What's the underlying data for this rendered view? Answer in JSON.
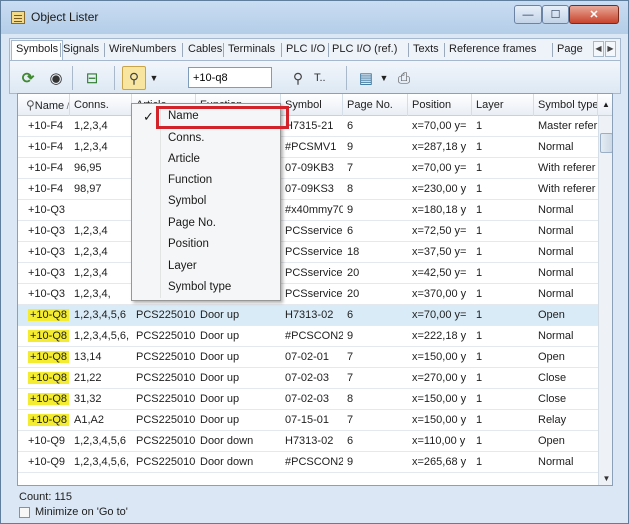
{
  "window": {
    "title": "Object Lister"
  },
  "tabs": [
    {
      "label": "Symbols",
      "active": true
    },
    {
      "label": "Signals"
    },
    {
      "label": "WireNumbers"
    },
    {
      "label": "Cables"
    },
    {
      "label": "Terminals"
    },
    {
      "label": "PLC I/O"
    },
    {
      "label": "PLC I/O (ref.)"
    },
    {
      "label": "Texts"
    },
    {
      "label": "Reference frames"
    },
    {
      "label": "Page"
    }
  ],
  "toolbar": {
    "search_value": "+10-q8",
    "find_label": "T.."
  },
  "columns": [
    "Name",
    "Conns.",
    "Article",
    "Function",
    "Symbol",
    "Page No.",
    "Position",
    "Layer",
    "Symbol type"
  ],
  "rows": [
    {
      "name": "+10-F4",
      "conns": "1,2,3,4",
      "article": "",
      "function": "",
      "symbol": "H7315-21",
      "page": "6",
      "position": "x=70,00 y=",
      "layer": "1",
      "type": "Master refer"
    },
    {
      "name": "+10-F4",
      "conns": "1,2,3,4",
      "article": "",
      "function": "",
      "symbol": "#PCSMV1",
      "page": "9",
      "position": "x=287,18 y",
      "layer": "1",
      "type": "Normal"
    },
    {
      "name": "+10-F4",
      "conns": "96,95",
      "article": "",
      "function": "",
      "symbol": "07-09KB3",
      "page": "7",
      "position": "x=70,00 y=",
      "layer": "1",
      "type": "With referer"
    },
    {
      "name": "+10-F4",
      "conns": "98,97",
      "article": "",
      "function": "",
      "symbol": "07-09KS3",
      "page": "8",
      "position": "x=230,00 y",
      "layer": "1",
      "type": "With referer"
    },
    {
      "name": "+10-Q3",
      "conns": "",
      "article": "",
      "function": "",
      "symbol": "#x40mmy70",
      "page": "9",
      "position": "x=180,18 y",
      "layer": "1",
      "type": "Normal"
    },
    {
      "name": "+10-Q3",
      "conns": "1,2,3,4",
      "article": "",
      "function": "",
      "symbol": "PCSserviceb",
      "page": "6",
      "position": "x=72,50 y=",
      "layer": "1",
      "type": "Normal"
    },
    {
      "name": "+10-Q3",
      "conns": "1,2,3,4",
      "article": "",
      "function": "",
      "symbol": "PCSserviceb",
      "page": "18",
      "position": "x=37,50 y=",
      "layer": "1",
      "type": "Normal"
    },
    {
      "name": "+10-Q3",
      "conns": "1,2,3,4",
      "article": "",
      "function": "",
      "symbol": "PCSserviceb",
      "page": "20",
      "position": "x=42,50 y=",
      "layer": "1",
      "type": "Normal"
    },
    {
      "name": "+10-Q3",
      "conns": "1,2,3,4,",
      "article": "",
      "function": "",
      "symbol": "PCSserviceb",
      "page": "20",
      "position": "x=370,00 y",
      "layer": "1",
      "type": "Normal"
    },
    {
      "name": "+10-Q8",
      "conns": "1,2,3,4,5,6",
      "article": "PCS2250106",
      "function": "Door up",
      "symbol": "H7313-02",
      "page": "6",
      "position": "x=70,00 y=",
      "layer": "1",
      "type": "Open",
      "highlight": true,
      "selected": true
    },
    {
      "name": "+10-Q8",
      "conns": "1,2,3,4,5,6,",
      "article": "PCS2250106",
      "function": "Door up",
      "symbol": "#PCSCON2",
      "page": "9",
      "position": "x=222,18 y",
      "layer": "1",
      "type": "Normal",
      "highlight": true
    },
    {
      "name": "+10-Q8",
      "conns": "13,14",
      "article": "PCS2250106",
      "function": "Door up",
      "symbol": "07-02-01",
      "page": "7",
      "position": "x=150,00 y",
      "layer": "1",
      "type": "Open",
      "highlight": true
    },
    {
      "name": "+10-Q8",
      "conns": "21,22",
      "article": "PCS2250106",
      "function": "Door up",
      "symbol": "07-02-03",
      "page": "7",
      "position": "x=270,00 y",
      "layer": "1",
      "type": "Close",
      "highlight": true
    },
    {
      "name": "+10-Q8",
      "conns": "31,32",
      "article": "PCS2250106",
      "function": "Door up",
      "symbol": "07-02-03",
      "page": "8",
      "position": "x=150,00 y",
      "layer": "1",
      "type": "Close",
      "highlight": true
    },
    {
      "name": "+10-Q8",
      "conns": "A1,A2",
      "article": "PCS2250106",
      "function": "Door up",
      "symbol": "07-15-01",
      "page": "7",
      "position": "x=150,00 y",
      "layer": "1",
      "type": "Relay",
      "highlight": true
    },
    {
      "name": "+10-Q9",
      "conns": "1,2,3,4,5,6",
      "article": "PCS2250106",
      "function": "Door down",
      "symbol": "H7313-02",
      "page": "6",
      "position": "x=110,00 y",
      "layer": "1",
      "type": "Open"
    },
    {
      "name": "+10-Q9",
      "conns": "1,2,3,4,5,6,",
      "article": "PCS2250106",
      "function": "Door down",
      "symbol": "#PCSCON2",
      "page": "9",
      "position": "x=265,68 y",
      "layer": "1",
      "type": "Normal"
    }
  ],
  "context_menu": {
    "items": [
      {
        "label": "Name",
        "checked": true
      },
      {
        "label": "Conns."
      },
      {
        "label": "Article"
      },
      {
        "label": "Function"
      },
      {
        "label": "Symbol"
      },
      {
        "label": "Page No."
      },
      {
        "label": "Position"
      },
      {
        "label": "Layer"
      },
      {
        "label": "Symbol type"
      }
    ]
  },
  "status": {
    "count": "Count: 115",
    "minimize_label": "Minimize on 'Go to'"
  },
  "colors": {
    "highlight": "#f4ec30",
    "selected_row": "#d9ebf7",
    "annotation_box": "#d2232a"
  }
}
